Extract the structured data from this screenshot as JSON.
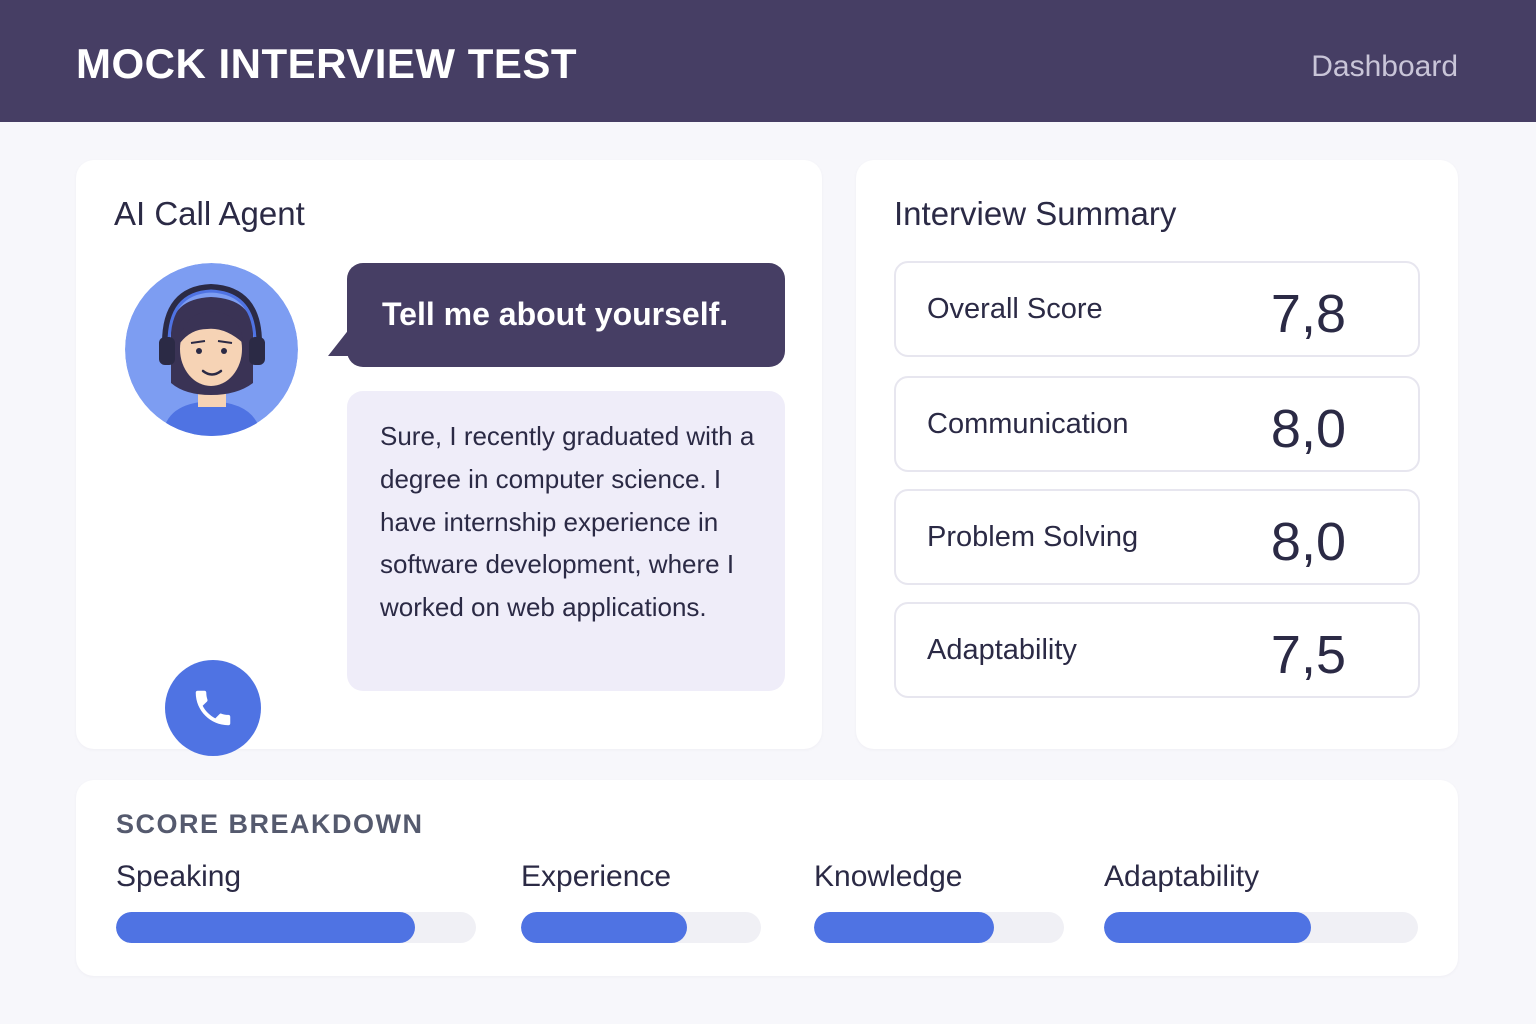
{
  "header": {
    "title": "MOCK INTERVIEW TEST",
    "nav_link": "Dashboard"
  },
  "agent": {
    "title": "AI Call Agent",
    "question": "Tell me about yourself.",
    "answer": "Sure, I recently graduated with a degree in computer science. I have internship experience in software development, where I worked on web applications.",
    "call_icon": "phone-icon",
    "avatar_icon": "headset-agent-avatar"
  },
  "summary": {
    "title": "Interview Summary",
    "metrics": [
      {
        "label": "Overall Score",
        "value": "7,8"
      },
      {
        "label": "Communication",
        "value": "8,0"
      },
      {
        "label": "Problem Solving",
        "value": "8,0"
      },
      {
        "label": "Adaptability",
        "value": "7,5"
      }
    ]
  },
  "breakdown": {
    "title": "SCORE BREAKDOWN",
    "items": [
      {
        "label": "Speaking",
        "progress": 0.83
      },
      {
        "label": "Experience",
        "progress": 0.69
      },
      {
        "label": "Knowledge",
        "progress": 0.72
      },
      {
        "label": "Adaptability",
        "progress": 0.66
      }
    ]
  },
  "colors": {
    "header_bg": "#463e64",
    "accent": "#4f73e3",
    "answer_bubble": "#efedf9"
  }
}
